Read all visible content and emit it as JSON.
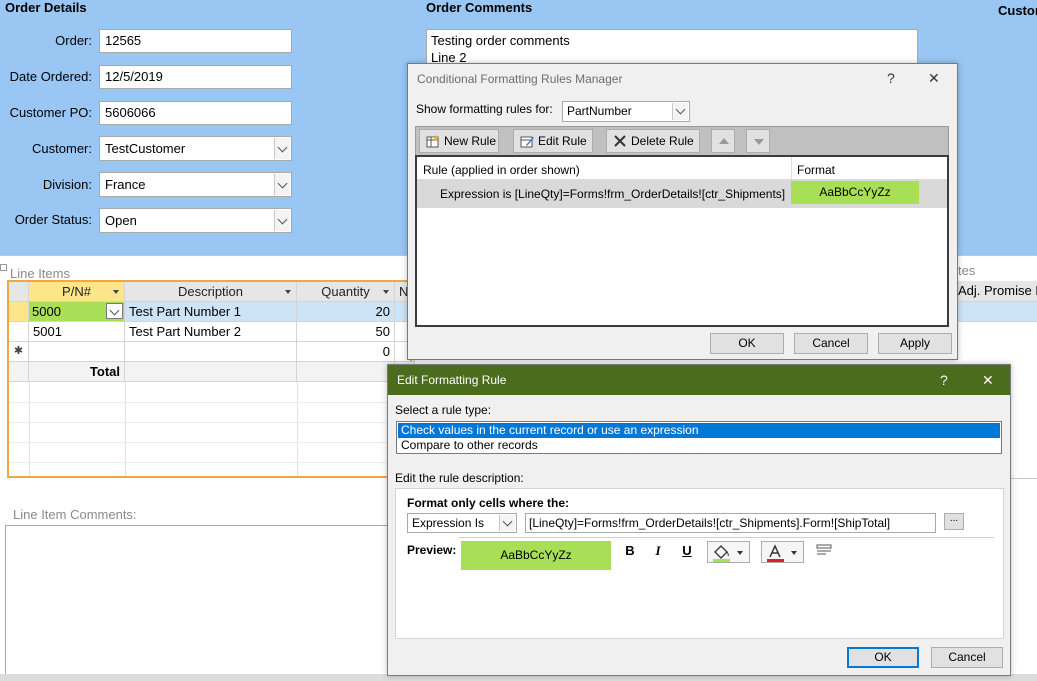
{
  "order_details": {
    "title": "Order Details",
    "order_label": "Order:",
    "order_value": "12565",
    "date_label": "Date Ordered:",
    "date_value": "12/5/2019",
    "po_label": "Customer PO:",
    "po_value": "5606066",
    "customer_label": "Customer:",
    "customer_value": "TestCustomer",
    "division_label": "Division:",
    "division_value": "France",
    "status_label": "Order Status:",
    "status_value": "Open"
  },
  "order_comments": {
    "title": "Order Comments",
    "line1": "Testing order comments",
    "line2": "Line 2"
  },
  "right_partial_title": "Custor",
  "line_items": {
    "title": "Line Items",
    "columns": [
      "P/N#",
      "Description",
      "Quantity",
      "N"
    ],
    "rows": [
      {
        "pn": "5000",
        "description": "Test Part Number 1",
        "quantity": "20"
      },
      {
        "pn": "5001",
        "description": "Test Part Number 2",
        "quantity": "50"
      },
      {
        "pn": "",
        "description": "",
        "quantity": "0"
      }
    ],
    "new_row_marker": "✱",
    "total_label": "Total"
  },
  "right_partial": {
    "notes_fragment": "tes",
    "adj_promise_header": "Adj. Promise I"
  },
  "line_item_comments_label": "Line Item Comments:",
  "cfrm": {
    "title": "Conditional Formatting Rules Manager",
    "help": "?",
    "close": "✕",
    "show_rules_label": "Show formatting rules for:",
    "show_rules_value": "PartNumber",
    "new_rule": "New Rule",
    "edit_rule": "Edit Rule",
    "delete_rule": "Delete Rule",
    "col_rule": "Rule (applied in order shown)",
    "col_format": "Format",
    "rule_text": "Expression is [LineQty]=Forms!frm_OrderDetails![ctr_Shipments].F...",
    "rule_format_sample": "AaBbCcYyZz",
    "ok": "OK",
    "cancel": "Cancel",
    "apply": "Apply"
  },
  "efr": {
    "title": "Edit Formatting Rule",
    "help": "?",
    "close": "✕",
    "select_type_label": "Select a rule type:",
    "rule_types": [
      "Check values in the current record or use an expression",
      "Compare to other records"
    ],
    "edit_desc_label": "Edit the rule description:",
    "format_only_label": "Format only cells where the:",
    "condition_value": "Expression Is",
    "expression_value": "[LineQty]=Forms!frm_OrderDetails![ctr_Shipments].Form![ShipTotal]",
    "ellipsis": "...",
    "preview_label": "Preview:",
    "preview_sample": "AaBbCcYyZz",
    "bold": "B",
    "italic": "I",
    "underline": "U",
    "ok": "OK",
    "cancel": "Cancel"
  },
  "colors": {
    "form_bg": "#99c6f3",
    "title_bar": "#4b6b1d",
    "preview_fill": "#a9df56",
    "selection": "#0078d7",
    "grid_border": "#f4a640"
  }
}
